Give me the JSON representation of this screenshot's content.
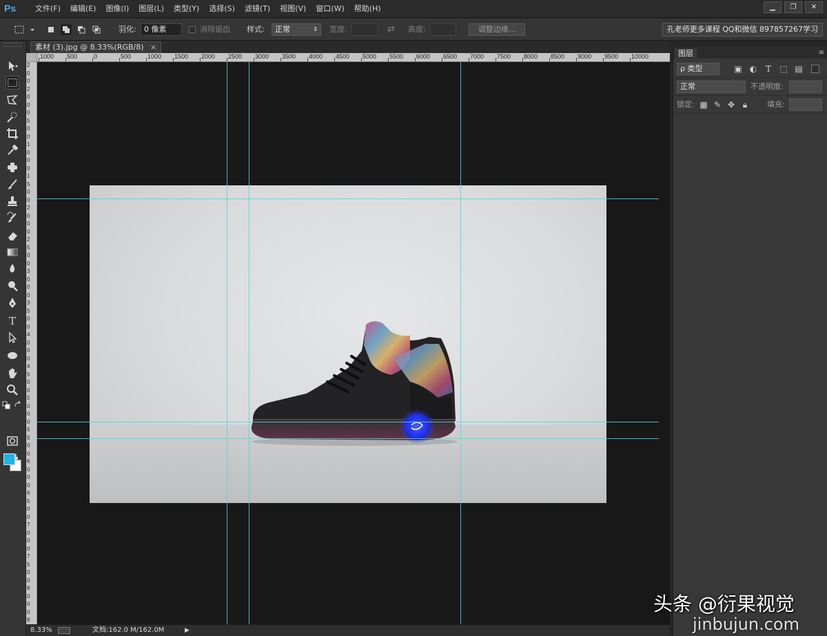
{
  "app": {
    "logo": "Ps",
    "menus": [
      "文件(F)",
      "编辑(E)",
      "图像(I)",
      "图层(L)",
      "类型(Y)",
      "选择(S)",
      "滤镜(T)",
      "视图(V)",
      "窗口(W)",
      "帮助(H)"
    ],
    "window_controls": {
      "minimize": "▁",
      "restore": "❐",
      "close": "✕"
    }
  },
  "options": {
    "feather_label": "羽化:",
    "feather_value": "0 像素",
    "antialias_label": "消除锯齿",
    "style_label": "样式:",
    "style_value": "正常",
    "width_label": "宽度:",
    "height_label": "高度:",
    "refine_edge": "调整边缘...",
    "promo": "孔老师更多课程 QQ和微信 897857267学习"
  },
  "document": {
    "tab_title": "素材 (3).jpg @ 8.33%(RGB/8)",
    "close": "×"
  },
  "rulers": {
    "top": [
      "1000",
      "500",
      "0",
      "500",
      "1000",
      "1500",
      "2000",
      "2500",
      "3000",
      "3500",
      "4000",
      "4500",
      "5000",
      "5500",
      "6000",
      "6500",
      "7000",
      "7500",
      "8000",
      "8500",
      "9000",
      "9500",
      "10000"
    ],
    "left": [
      "2",
      "0",
      "0",
      "2",
      "0",
      "0",
      "0",
      "5",
      "0",
      "0",
      "1",
      "0",
      "0",
      "0",
      "1",
      "5",
      "0",
      "0",
      "2",
      "0",
      "0",
      "0",
      "2",
      "5",
      "0",
      "0",
      "3",
      "0",
      "0",
      "0",
      "3",
      "5",
      "0",
      "0",
      "4",
      "0",
      "0",
      "0",
      "4",
      "5",
      "0",
      "0",
      "5",
      "0",
      "0",
      "0",
      "5",
      "5",
      "0",
      "0",
      "6",
      "0",
      "0",
      "0",
      "6",
      "5",
      "0",
      "0",
      "7",
      "0",
      "0",
      "0",
      "7",
      "5",
      "0",
      "0",
      "8",
      "0",
      "0",
      "0",
      "8"
    ]
  },
  "colors": {
    "foreground": "#1fb3e6",
    "background": "#ffffff",
    "guide": "#4fd3e8"
  },
  "status": {
    "zoom": "8.33%",
    "doc_info": "文档:162.0 M/162.0M"
  },
  "layers_panel": {
    "tab": "图层",
    "filter_label": "ρ 类型",
    "blend_mode": "正常",
    "opacity_label": "不透明度:",
    "lock_label": "锁定:",
    "fill_label": "填充:"
  },
  "watermark": {
    "brand": "头条 @衍果视觉",
    "url": "jinbujun.com"
  }
}
